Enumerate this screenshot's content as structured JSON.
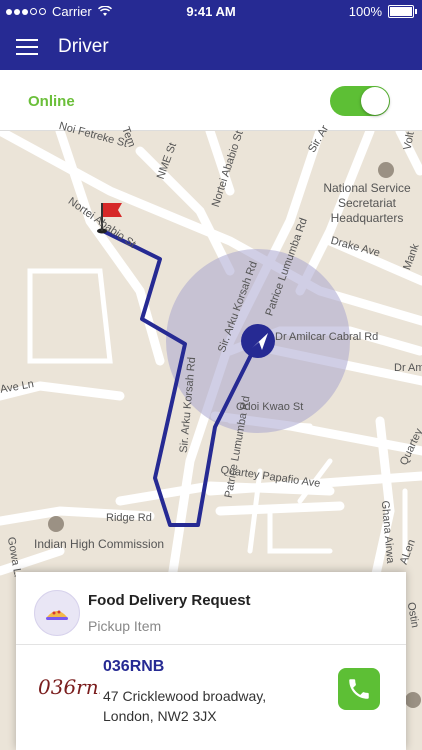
{
  "status_bar": {
    "carrier": "Carrier",
    "time": "9:41 AM",
    "battery": "100%"
  },
  "header": {
    "title": "Driver",
    "menu_icon": "hamburger-icon"
  },
  "online": {
    "label": "Online",
    "toggle_on": true,
    "accent": "#5dbf35"
  },
  "map": {
    "streets": [
      "Noi Fetreke St",
      "NME St",
      "Nortei Ababio St",
      "Tem",
      "Sir. Arku Korsah Rd",
      "Patrice Lumumba Rd",
      "Dr Amilcar Cabral Rd",
      "Dr Ami",
      "Drake Ave",
      "Mank",
      "Odoi Kwao St",
      "Quartey Papafio Ave",
      "Quartey",
      "Ridge Rd",
      "Ghana Airwa",
      "ALen",
      "Ave Ln",
      "Gowa Li",
      "Volt",
      "Sir. Ar",
      "Nortei Ababio St",
      "Sir. Arku Korsah Rd",
      "Patrice Lumumba Rd",
      "Ostin"
    ],
    "pois": [
      "National Service Secretariat Headquarters",
      "Indian High Commission"
    ],
    "route_color": "#262a93"
  },
  "request": {
    "title": "Food Delivery Request",
    "subtitle": "Pickup Item",
    "restaurant": "036RNB",
    "address": "47 Cricklewood broadway, London, NW2 3JX",
    "logo_text": "036rnb",
    "call_icon": "phone-icon"
  }
}
